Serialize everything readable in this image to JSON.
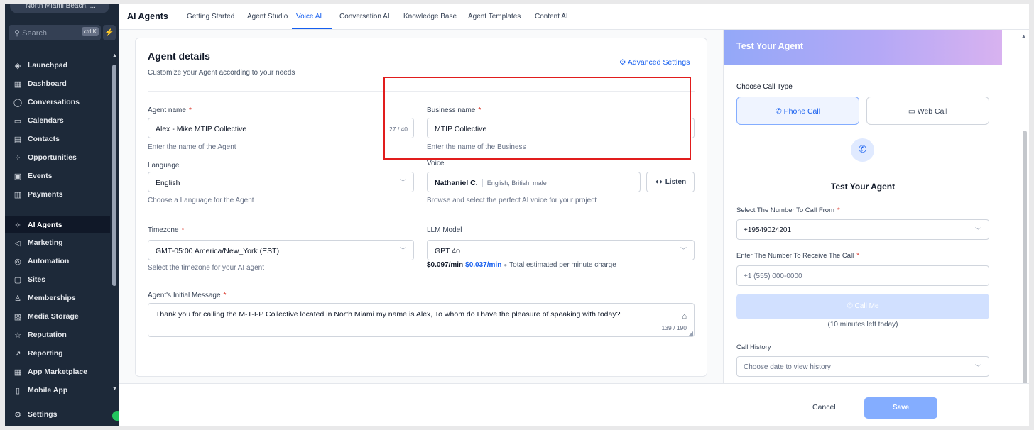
{
  "sidebar": {
    "location": "North Miami Beach, ...",
    "search_placeholder": "Search",
    "search_shortcut": "ctrl K",
    "items": [
      {
        "label": "Launchpad"
      },
      {
        "label": "Dashboard"
      },
      {
        "label": "Conversations"
      },
      {
        "label": "Calendars"
      },
      {
        "label": "Contacts"
      },
      {
        "label": "Opportunities"
      },
      {
        "label": "Events"
      },
      {
        "label": "Payments"
      },
      {
        "label": "AI Agents"
      },
      {
        "label": "Marketing"
      },
      {
        "label": "Automation"
      },
      {
        "label": "Sites"
      },
      {
        "label": "Memberships"
      },
      {
        "label": "Media Storage"
      },
      {
        "label": "Reputation"
      },
      {
        "label": "Reporting"
      },
      {
        "label": "App Marketplace"
      },
      {
        "label": "Mobile App"
      },
      {
        "label": "Settings"
      }
    ]
  },
  "header": {
    "title": "AI Agents",
    "tabs": [
      {
        "label": "Getting Started"
      },
      {
        "label": "Agent Studio"
      },
      {
        "label": "Voice AI"
      },
      {
        "label": "Conversation AI"
      },
      {
        "label": "Knowledge Base"
      },
      {
        "label": "Agent Templates"
      },
      {
        "label": "Content AI"
      }
    ]
  },
  "details": {
    "title": "Agent details",
    "subtitle": "Customize your Agent according to your needs",
    "advanced": "Advanced Settings",
    "agent_name": {
      "label": "Agent name",
      "value": "Alex - Mike MTIP Collective",
      "count": "27 / 40",
      "help": "Enter the name of the Agent"
    },
    "business_name": {
      "label": "Business name",
      "value": "MTIP Collective",
      "help": "Enter the name of the Business"
    },
    "language": {
      "label": "Language",
      "value": "English",
      "help": "Choose a Language for the Agent"
    },
    "voice": {
      "label": "Voice",
      "name": "Nathaniel C.",
      "desc": "English, British, male",
      "help": "Browse and select the perfect AI voice for your project",
      "listen": "Listen"
    },
    "timezone": {
      "label": "Timezone",
      "value": "GMT-05:00 America/New_York (EST)",
      "help": "Select the timezone for your AI agent"
    },
    "llm": {
      "label": "LLM Model",
      "value": "GPT 4o",
      "old_price": "$0.097/min",
      "new_price": "$0.037/min",
      "price_note": "Total estimated per minute charge"
    },
    "initial_message": {
      "label": "Agent's Initial Message",
      "value": "Thank you for calling the M-T-I-P Collective located in North Miami my name is Alex, To whom do I have the pleasure of speaking with today?",
      "count": "139 / 190"
    }
  },
  "test_panel": {
    "title": "Test Your Agent",
    "call_type_label": "Choose Call Type",
    "phone_call": "Phone Call",
    "web_call": "Web Call",
    "center_title": "Test Your Agent",
    "from_label": "Select The Number To Call From",
    "from_value": "+19549024201",
    "to_label": "Enter The Number To Receive The Call",
    "to_placeholder": "+1 (555) 000-0000",
    "call_me": "Call Me",
    "minutes_left": "(10 minutes left today)",
    "history_label": "Call History",
    "history_placeholder": "Choose date to view history"
  },
  "footer": {
    "cancel": "Cancel",
    "save": "Save"
  },
  "colors": {
    "accent": "#155eef",
    "sidebar_bg": "#1d2939",
    "highlight_box": "#e11d1d"
  }
}
